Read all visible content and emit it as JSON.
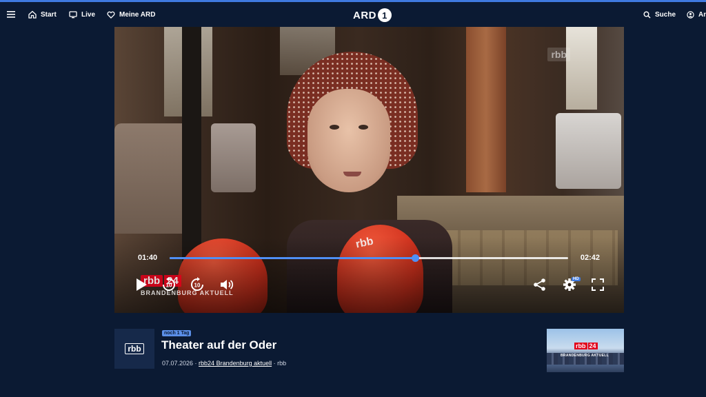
{
  "header": {
    "menu_icon": "menu-icon",
    "nav": [
      {
        "label": "Start",
        "icon": "home-icon"
      },
      {
        "label": "Live",
        "icon": "tv-icon"
      },
      {
        "label": "Meine ARD",
        "icon": "heart-icon"
      }
    ],
    "logo_text": "ARD",
    "logo_mark": "1",
    "search_label": "Suche",
    "profile_label": "An"
  },
  "player": {
    "watermark": "rbb",
    "station_logo_left": "rbb",
    "station_logo_num": "24",
    "station_name": "BRANDENBURG AKTUELL",
    "mic_logo": "rbb",
    "current_time": "01:40",
    "duration": "02:42",
    "progress_fraction": 0.617,
    "skip_back_label": "10",
    "skip_forward_label": "10",
    "hd_label": "HD",
    "accent_color": "#4f8ff5"
  },
  "info": {
    "channel_logo": "rbb",
    "badge": "noch 1 Tag",
    "title": "Theater auf der Oder",
    "date": "07.07.2026",
    "separator": " · ",
    "show_link": "rbb24 Brandenburg aktuell",
    "channel": "rbb"
  },
  "thumbnail": {
    "logo_left": "rbb",
    "logo_num": "24",
    "caption": "BRANDENBURG AKTUELL"
  },
  "colors": {
    "background": "#0b1a33",
    "accent": "#3f7ae0",
    "rbb_red": "#e2001a"
  }
}
